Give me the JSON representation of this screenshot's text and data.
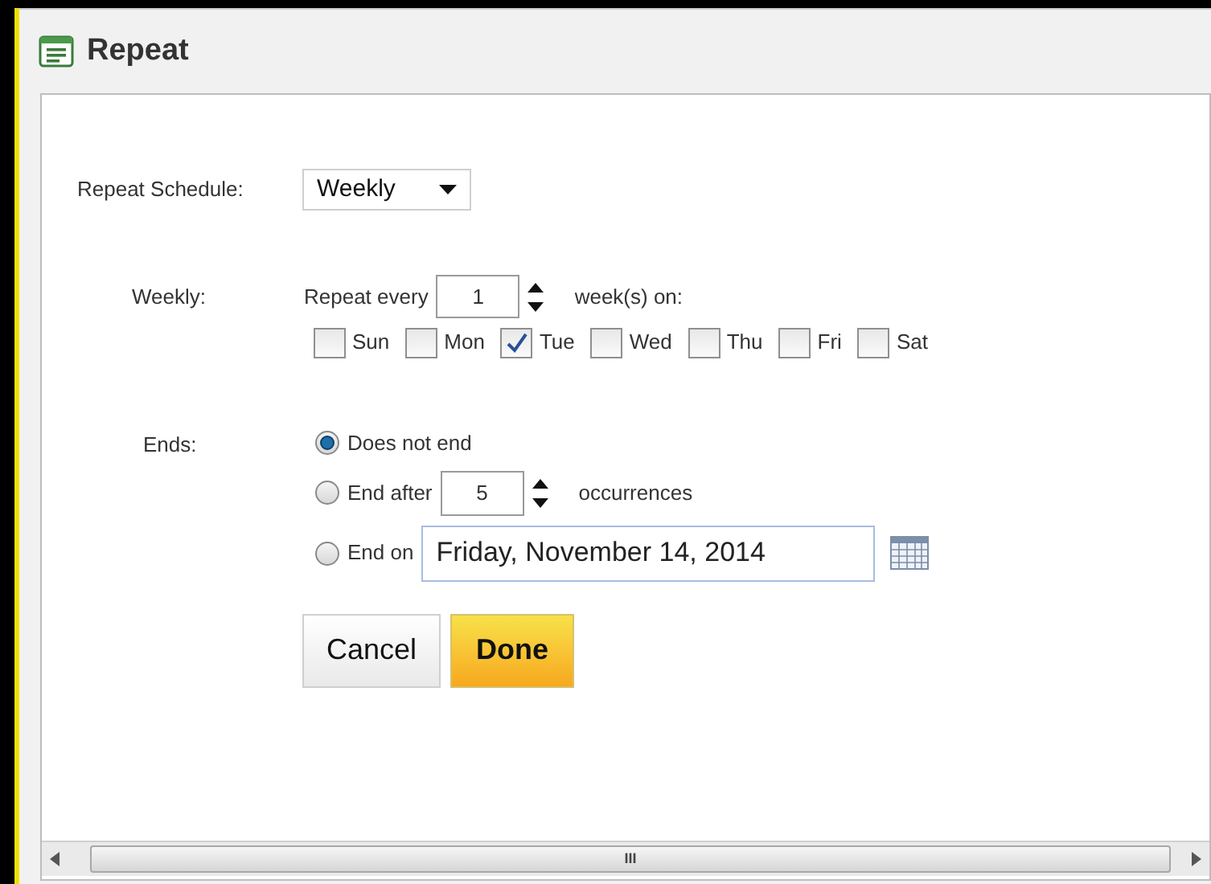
{
  "window": {
    "title": "Repeat"
  },
  "schedule": {
    "label": "Repeat Schedule:",
    "value": "Weekly"
  },
  "weekly": {
    "label": "Weekly:",
    "prefix": "Repeat every",
    "value": "1",
    "suffix": "week(s) on:",
    "days": [
      {
        "label": "Sun",
        "checked": false
      },
      {
        "label": "Mon",
        "checked": false
      },
      {
        "label": "Tue",
        "checked": true
      },
      {
        "label": "Wed",
        "checked": false
      },
      {
        "label": "Thu",
        "checked": false
      },
      {
        "label": "Fri",
        "checked": false
      },
      {
        "label": "Sat",
        "checked": false
      }
    ]
  },
  "ends": {
    "label": "Ends:",
    "options": [
      {
        "kind": "plain",
        "label": "Does not end",
        "selected": true
      },
      {
        "kind": "count",
        "label": "End after",
        "value": "5",
        "suffix": "occurrences",
        "selected": false
      },
      {
        "kind": "date",
        "label": "End on",
        "value": "Friday, November 14, 2014",
        "selected": false
      }
    ]
  },
  "buttons": [
    {
      "kind": "secondary",
      "label": "Cancel"
    },
    {
      "kind": "primary",
      "label": "Done"
    }
  ],
  "scrollbar_grip": "III"
}
